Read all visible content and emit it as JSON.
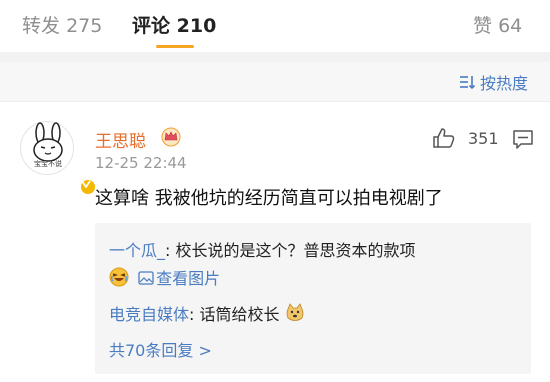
{
  "tabs": {
    "repost_label": "转发",
    "repost_count": "275",
    "comment_label": "评论",
    "comment_count": "210",
    "like_label": "赞",
    "like_count": "64"
  },
  "sort": {
    "label": "按热度"
  },
  "comment": {
    "username": "王思聪",
    "time": "12-25 22:44",
    "likes": "351",
    "text": "这算啥 我被他坑的经历简直可以拍电视剧了",
    "avatar_caption": "宝宝不说",
    "replies": [
      {
        "name": "一个瓜_",
        "text": ": 校长说的是这个？普思资本的款项"
      },
      {
        "name": "电竞自媒体",
        "text": ": 话筒给校长"
      }
    ],
    "view_image_label": "查看图片",
    "more_replies_label": "共70条回复 >"
  },
  "colors": {
    "link": "#4a7cc1",
    "username": "#e86c2b",
    "accent": "#f5a623",
    "badge": "#f5b800"
  }
}
